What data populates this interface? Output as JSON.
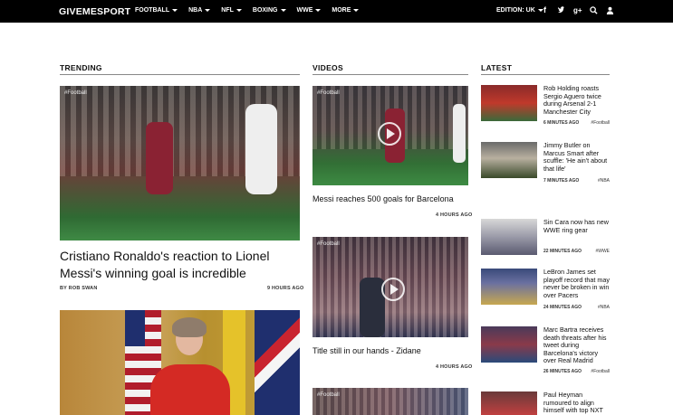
{
  "nav": {
    "logo": "GIVEMESPORT",
    "items": [
      "FOOTBALL",
      "NBA",
      "NFL",
      "BOXING",
      "WWE",
      "MORE"
    ],
    "edition": "EDITION: UK",
    "icons": [
      "facebook-icon",
      "twitter-icon",
      "google-plus-icon",
      "search-icon",
      "user-icon"
    ]
  },
  "sections": {
    "trending": "TRENDING",
    "videos": "VIDEOS",
    "latest": "LATEST"
  },
  "trending": [
    {
      "tag": "#Football",
      "title": "Cristiano Ronaldo's reaction to Lionel Messi's winning goal is incredible",
      "author": "BY ROB SWAN",
      "time": "9 HOURS AGO"
    }
  ],
  "videos": [
    {
      "tag": "#Football",
      "title": "Messi reaches 500 goals for Barcelona",
      "time": "4 HOURS AGO"
    },
    {
      "tag": "#Football",
      "title": "Title still in our hands - Zidane",
      "time": "4 HOURS AGO"
    },
    {
      "tag": "#Football"
    }
  ],
  "latest": [
    {
      "title": "Rob Holding roasts Sergio Aguero twice during Arsenal 2-1 Manchester City",
      "time": "6 MINUTES AGO",
      "tag": "#Football"
    },
    {
      "title": "Jimmy Butler on Marcus Smart after scuffle: 'He ain't about that life'",
      "time": "7 MINUTES AGO",
      "tag": "#NBA"
    },
    {
      "title": "Sin Cara now has new WWE ring gear",
      "time": "22 MINUTES AGO",
      "tag": "#WWE"
    },
    {
      "title": "LeBron James set playoff record that may never be broken in win over Pacers",
      "time": "24 MINUTES AGO",
      "tag": "#NBA"
    },
    {
      "title": "Marc Bartra receives death threats after his tweet during Barcelona's victory over Real Madrid",
      "time": "26 MINUTES AGO",
      "tag": "#Football"
    },
    {
      "title": "Paul Heyman rumoured to align himself with top NXT"
    }
  ]
}
